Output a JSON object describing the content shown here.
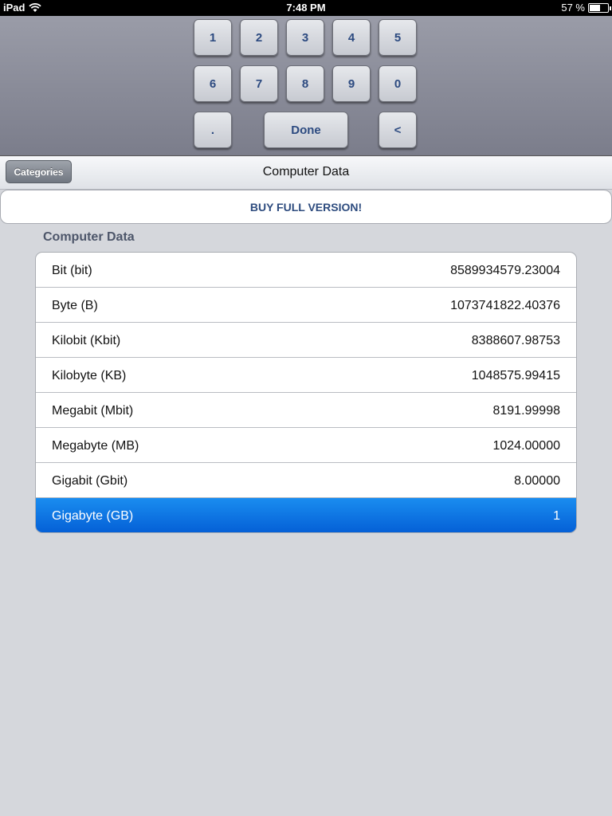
{
  "status_bar": {
    "device": "iPad",
    "time": "7:48 PM",
    "battery": "57 %",
    "battery_level": 0.57
  },
  "keypad": {
    "row1": [
      "1",
      "2",
      "3",
      "4",
      "5"
    ],
    "row2": [
      "6",
      "7",
      "8",
      "9",
      "0"
    ],
    "decimal": ".",
    "done": "Done",
    "backspace": "<"
  },
  "navbar": {
    "back_label": "Categories",
    "title": "Computer Data"
  },
  "buy_label": "BUY FULL VERSION!",
  "section_header": "Computer Data",
  "units": [
    {
      "label": "Bit (bit)",
      "value": "8589934579.23004",
      "selected": false
    },
    {
      "label": "Byte (B)",
      "value": "1073741822.40376",
      "selected": false
    },
    {
      "label": "Kilobit (Kbit)",
      "value": "8388607.98753",
      "selected": false
    },
    {
      "label": "Kilobyte (KB)",
      "value": "1048575.99415",
      "selected": false
    },
    {
      "label": "Megabit (Mbit)",
      "value": "8191.99998",
      "selected": false
    },
    {
      "label": "Megabyte (MB)",
      "value": "1024.00000",
      "selected": false
    },
    {
      "label": "Gigabit (Gbit)",
      "value": "8.00000",
      "selected": false
    },
    {
      "label": "Gigabyte (GB)",
      "value": "1",
      "selected": true
    }
  ],
  "colors": {
    "accent_blue": "#0a6fe0",
    "key_text": "#2c4a80"
  }
}
